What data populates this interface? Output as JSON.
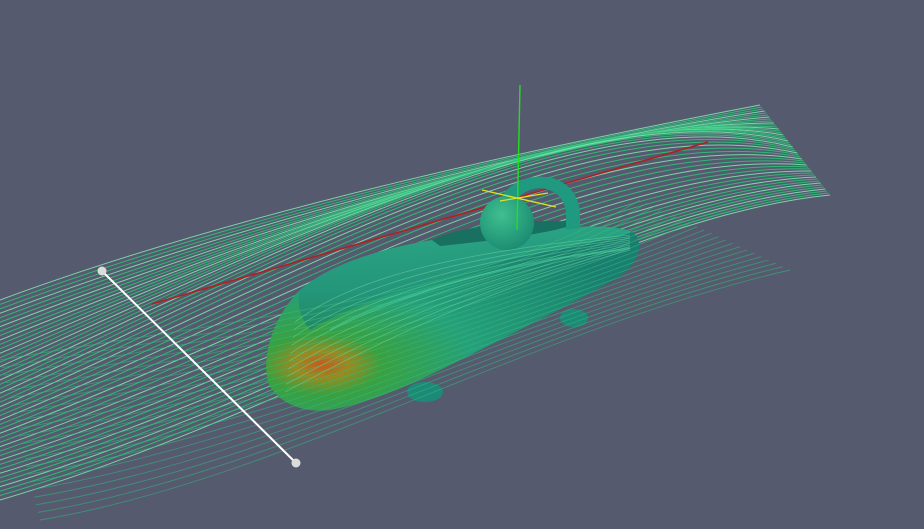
{
  "viewport": {
    "background_color": "#565a6e"
  },
  "visualization": {
    "type": "streamline-flow-around-vehicle",
    "colors": {
      "streamline": "#2fc07a",
      "streamline_light": "#7fe0b0",
      "body_base": "#1f8f7a",
      "body_highlight": "#2fb28a",
      "body_nose_hot": "#c65a1a",
      "body_nose_warm": "#9a9a20",
      "cockpit": "#2a9a80",
      "axis_x": "#b02020",
      "axis_y": "#20e020",
      "axis_z": "#e0e020",
      "seed_line": "#ffffff",
      "seed_handle": "#dcdcdc"
    }
  },
  "seed_line_widget": {
    "handles": [
      "seed-handle-start",
      "seed-handle-end"
    ]
  }
}
